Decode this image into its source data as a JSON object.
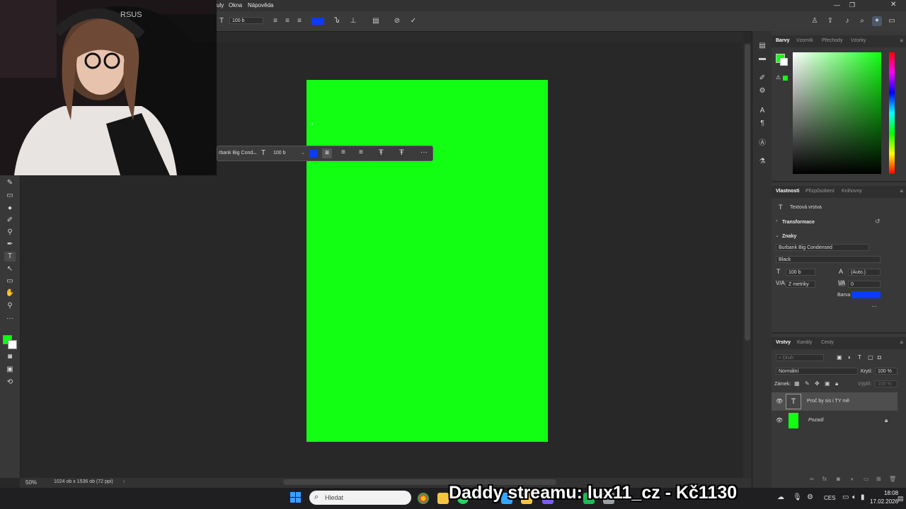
{
  "menubar": {
    "items": [
      "uly",
      "Okna",
      "Nápověda"
    ]
  },
  "options_bar": {
    "font_size": "100 b",
    "color_hex": "#0a3bff",
    "icons": [
      "text-orientation-icon",
      "size-icon",
      "align-left-icon",
      "align-center-icon",
      "align-right-icon",
      "color-swatch",
      "warp-text-icon",
      "text-baseline-icon",
      "character-panel-icon",
      "cancel-icon",
      "commit-icon"
    ],
    "right_icons": [
      "share-icon",
      "upload-icon",
      "bell-icon",
      "search-icon",
      "sparkle-icon",
      "workspace-icon"
    ]
  },
  "floating_toolbar": {
    "font_name": "rbank Big Cond...",
    "font_size": "100 b",
    "color_hex": "#0a3bff",
    "more": "···"
  },
  "document": {
    "background": "#12ff13",
    "zoom": "50%",
    "size_info": "1024 ob x 1536 ob (72 ppi)"
  },
  "color_panel": {
    "tabs": [
      "Barvy",
      "Vzorník",
      "Přechody",
      "Vzorky"
    ],
    "active_tab": "Barvy",
    "foreground": "#12ff13",
    "background": "#ffffff"
  },
  "properties_panel": {
    "tabs": [
      "Vlastnosti",
      "Přizpůsobení",
      "Knihovny"
    ],
    "layer_type": "Textová vrstva",
    "sections": [
      "Transformace",
      "Znaky"
    ],
    "font_family": "Burbank Big Condensed",
    "font_style": "Black",
    "font_size": "100 b",
    "leading": "(Auto.)",
    "kerning": "Z metriky",
    "tracking": "0",
    "color_label": "Barva",
    "color_hex": "#0a3bff",
    "more": "···"
  },
  "layers_panel": {
    "tabs": [
      "Vrstvy",
      "Kanály",
      "Cesty"
    ],
    "search_placeholder": "Druh",
    "blend_mode": "Normální",
    "opacity_label": "Krytí:",
    "opacity": "100 %",
    "lock_label": "Zámek:",
    "fill_label": "Výplň:",
    "fill": "100 %",
    "layers": [
      {
        "name": "Proč by sis i TY mě",
        "type": "text"
      },
      {
        "name": "Pozadí",
        "type": "background",
        "color": "#12ff13"
      }
    ]
  },
  "taskbar": {
    "search_placeholder": "Hledat",
    "overlay_text": "Daddy streamu: lux11_cz - Kč1130",
    "language": "CES",
    "time": "18:08",
    "date": "17.02.2026"
  }
}
